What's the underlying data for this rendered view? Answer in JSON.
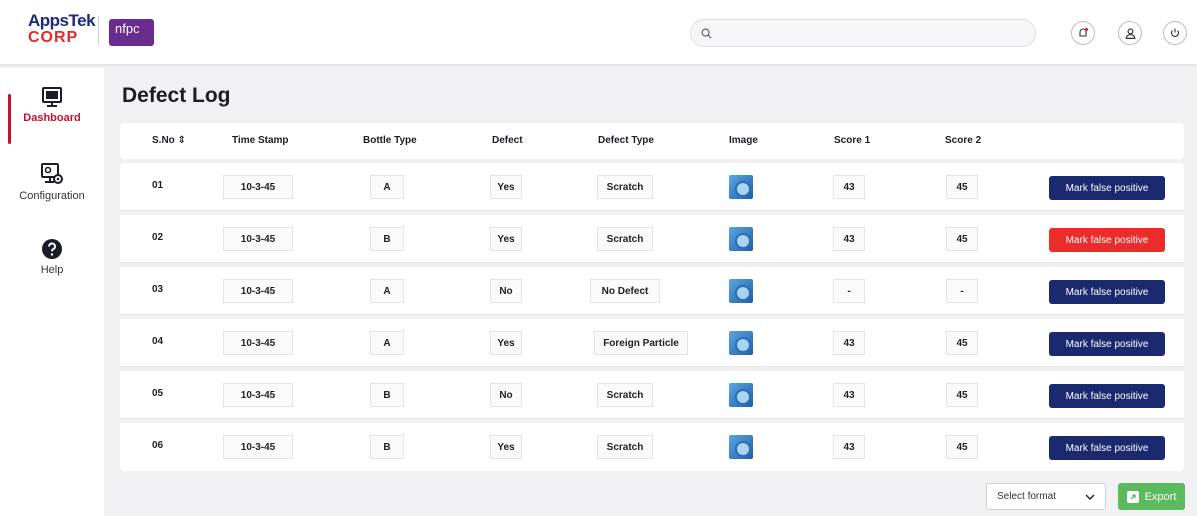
{
  "header": {
    "logo_apps_line1": "AppsTek",
    "logo_apps_line2": "CORP",
    "logo_nfpc": "nfpc",
    "search_placeholder": "",
    "icons": [
      "notification-icon",
      "user-icon",
      "power-icon"
    ]
  },
  "sidebar": {
    "items": [
      {
        "label": "Dashboard",
        "icon": "dashboard-icon",
        "active": true
      },
      {
        "label": "Configuration",
        "icon": "configuration-icon",
        "active": false
      },
      {
        "label": "Help",
        "icon": "help-icon",
        "active": false
      }
    ]
  },
  "page": {
    "title": "Defect Log"
  },
  "table": {
    "columns": [
      "S.No ⇕",
      "Time Stamp",
      "Bottle Type",
      "Defect",
      "Defect Type",
      "Image",
      "Score 1",
      "Score 2"
    ],
    "rows": [
      {
        "sno": "01",
        "timestamp": "10-3-45",
        "bottle": "A",
        "defect": "Yes",
        "type": "Scratch",
        "score1": "43",
        "score2": "45",
        "action": "Mark false positive"
      },
      {
        "sno": "02",
        "timestamp": "10-3-45",
        "bottle": "B",
        "defect": "Yes",
        "type": "Scratch",
        "score1": "43",
        "score2": "45",
        "action": "Mark false positive"
      },
      {
        "sno": "03",
        "timestamp": "10-3-45",
        "bottle": "A",
        "defect": "No",
        "type": "No Defect",
        "score1": "-",
        "score2": "-",
        "action": "Mark false positive"
      },
      {
        "sno": "04",
        "timestamp": "10-3-45",
        "bottle": "A",
        "defect": "Yes",
        "type": "Foreign Particle",
        "score1": "43",
        "score2": "45",
        "action": "Mark false positive"
      },
      {
        "sno": "05",
        "timestamp": "10-3-45",
        "bottle": "B",
        "defect": "No",
        "type": "Scratch",
        "score1": "43",
        "score2": "45",
        "action": "Mark false positive"
      },
      {
        "sno": "06",
        "timestamp": "10-3-45",
        "bottle": "B",
        "defect": "Yes",
        "type": "Scratch",
        "score1": "43",
        "score2": "45",
        "action": "Mark false positive"
      }
    ]
  },
  "footer": {
    "select_label": "Select format",
    "export_label": "Export"
  },
  "colors": {
    "brand_navy": "#1b2a6e",
    "highlight_red": "#ec2b2b",
    "export_green": "#5bb95e",
    "active_nav": "#c8102e",
    "nfpc_purple": "#6b2c8f"
  }
}
